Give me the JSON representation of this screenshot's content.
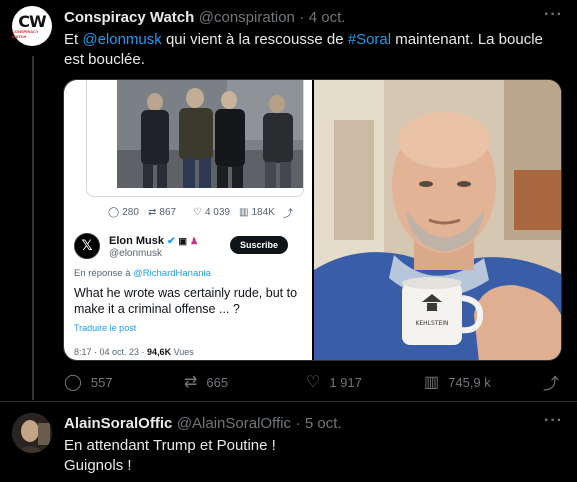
{
  "tweet1": {
    "author_name": "Conspiracy Watch",
    "handle": "@conspiration",
    "separator": "·",
    "date": "4 oct.",
    "avatar_text": "CW",
    "avatar_subtext": "CONSPIRACY WATCH",
    "text_before": "Et ",
    "mention": "@elonmusk",
    "text_middle": " qui vient à la rescousse de ",
    "hashtag": "#Soral",
    "text_after": " maintenant. La boucle est bouclée.",
    "more_icon": "more-horizontal-icon",
    "media": {
      "quoted_metrics": {
        "replies": "280",
        "retweets": "867",
        "likes": "4 039",
        "views": "184K"
      },
      "quoted_author_name": "Elon Musk",
      "quoted_handle": "@elonmusk",
      "subscribe_label": "Suscribe",
      "reply_label": "En réponse à ",
      "reply_handle": "@RichardHanania",
      "quoted_text": "What he wrote was certainly rude, but to make it a criminal offense ... ?",
      "translate_label": "Traduire le post",
      "meta_time": "8:17 · 04 oct. 23 · ",
      "meta_views_count": "94,6K",
      "meta_views_label": " Vues",
      "cup_text": "KEHLSTEIN"
    },
    "actions": {
      "replies": "557",
      "retweets": "665",
      "likes": "1 917",
      "views": "745,9 k"
    }
  },
  "tweet2": {
    "author_name": "AlainSoralOffic",
    "handle": "@AlainSoralOffic",
    "separator": "·",
    "date": "5 oct.",
    "line1": "En attendant Trump et Poutine !",
    "line2": "Guignols !",
    "more_icon": "more-horizontal-icon"
  },
  "colors": {
    "background": "#000000",
    "text": "#e7e9ea",
    "muted": "#71767b",
    "link": "#1d9bf0"
  }
}
